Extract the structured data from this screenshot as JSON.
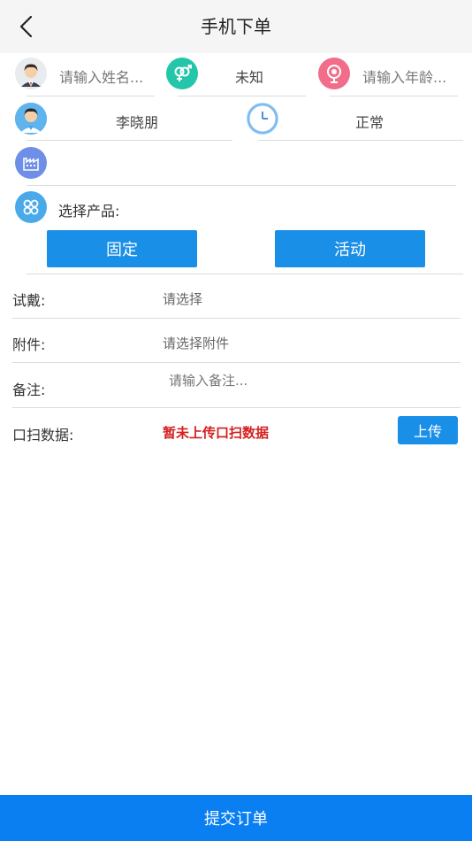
{
  "header": {
    "title": "手机下单"
  },
  "patient": {
    "name_placeholder": "请输入姓名...",
    "gender": "未知",
    "age_placeholder": "请输入年龄...",
    "doctor": "李晓朋",
    "status": "正常"
  },
  "product": {
    "label": "选择产品:",
    "fixed_label": "固定",
    "activity_label": "活动"
  },
  "form": {
    "trial_label": "试戴:",
    "trial_value": "请选择",
    "attachment_label": "附件:",
    "attachment_value": "请选择附件",
    "remark_label": "备注:",
    "remark_placeholder": "请输入备注...",
    "scan_label": "口扫数据:",
    "scan_status": "暂未上传口扫数据",
    "upload_label": "上传"
  },
  "footer": {
    "submit_label": "提交订单"
  },
  "colors": {
    "primary": "#1a8fe8",
    "submit": "#0a7ff2",
    "gender_icon": "#23c6a8",
    "age_icon": "#f16d8a",
    "clinic_icon": "#6e8fe8",
    "product_icon": "#49a9e9",
    "warning_text": "#d42020"
  },
  "icons": {
    "back": "chevron-left-icon",
    "patient": "avatar-icon",
    "gender": "gender-icon",
    "age": "balloon-icon",
    "doctor": "doctor-avatar-icon",
    "status": "clock-icon",
    "clinic": "factory-icon",
    "product": "grid-icon"
  }
}
